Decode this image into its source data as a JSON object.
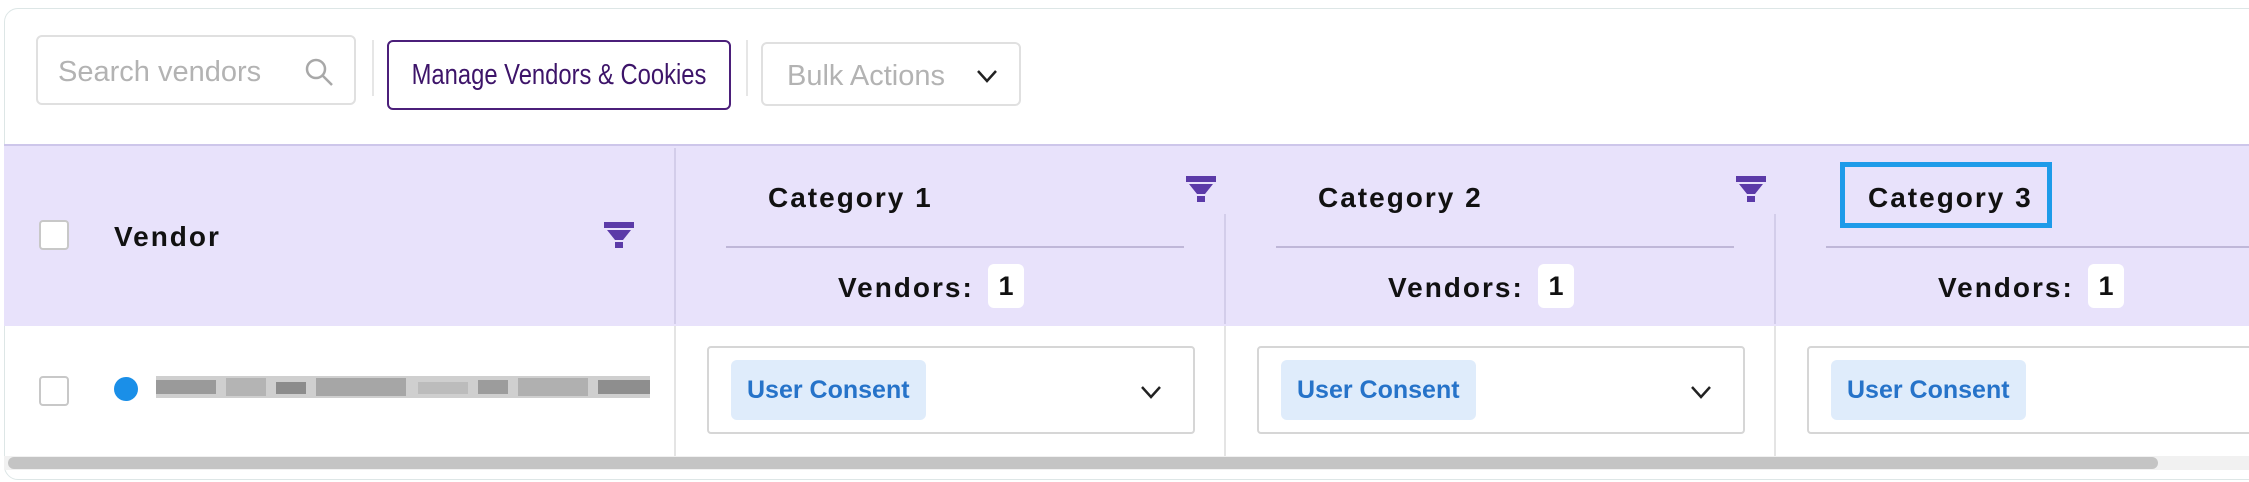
{
  "toolbar": {
    "search_placeholder": "Search vendors",
    "manage_label": "Manage Vendors & Cookies",
    "bulk_label": "Bulk Actions"
  },
  "table": {
    "vendor_header": "Vendor",
    "vendors_label": "Vendors:",
    "categories": [
      {
        "title": "Category 1",
        "count": "1"
      },
      {
        "title": "Category 2",
        "count": "1"
      },
      {
        "title": "Category 3",
        "count": "1"
      }
    ],
    "rows": [
      {
        "consent": [
          "User Consent",
          "User Consent",
          "User Consent"
        ],
        "status_color": "#1a8fe8"
      }
    ]
  },
  "colors": {
    "header_bg": "#e8e2fb",
    "accent": "#3d1469",
    "filter": "#5b3aa8",
    "highlight": "#1e9be9"
  }
}
